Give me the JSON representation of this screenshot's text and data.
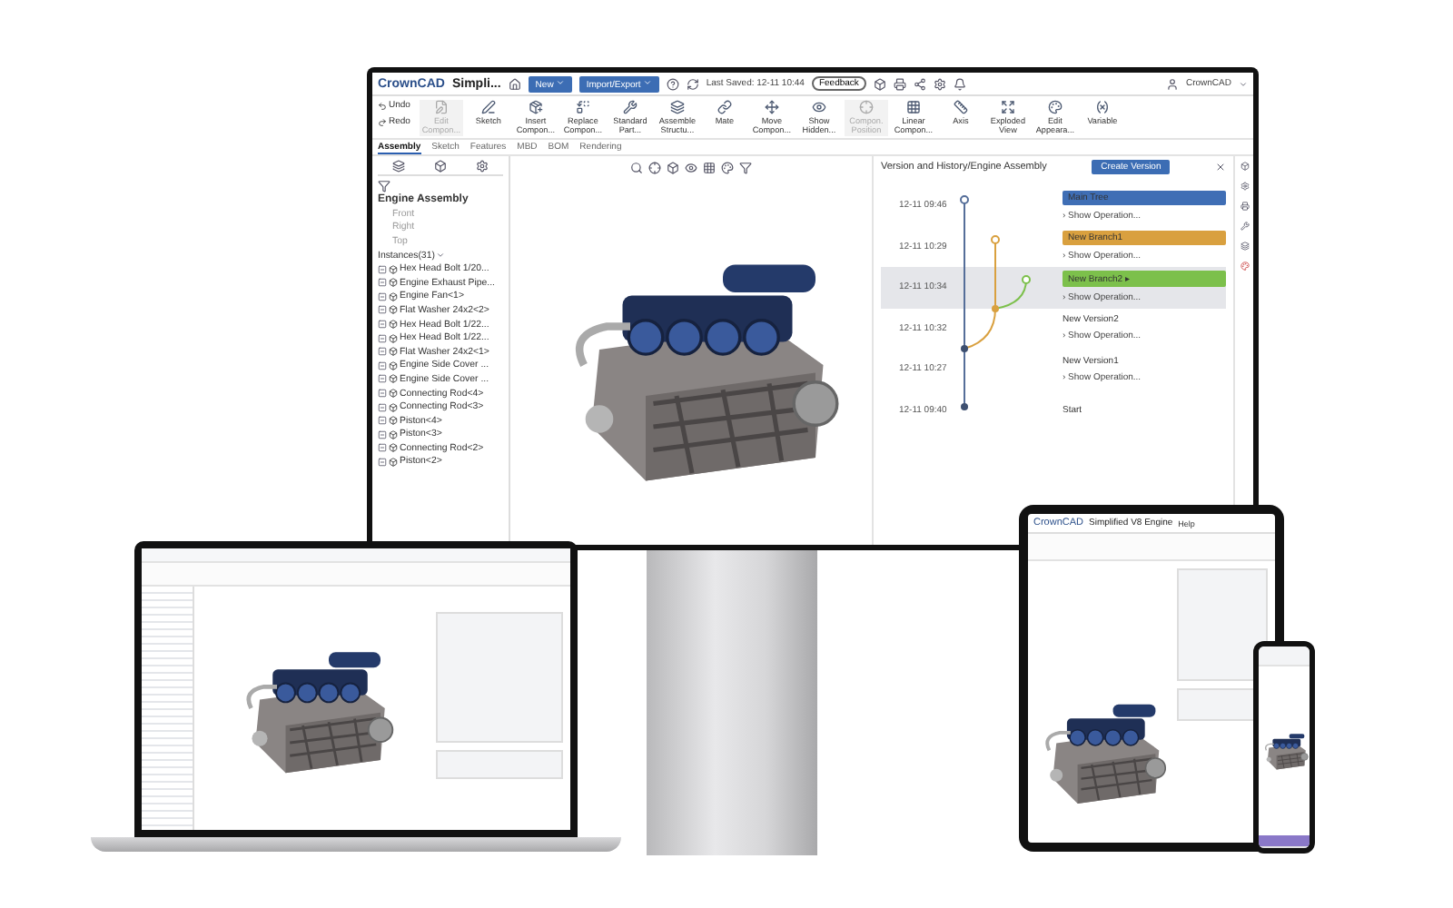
{
  "monitor": {
    "title_bar": {
      "logo": "CrownCAD",
      "document": "Simpli...",
      "buttons": [
        {
          "label": "New",
          "kind": "menu"
        },
        {
          "label": "Import/Export",
          "kind": "menu"
        }
      ],
      "last_saved": "Last Saved: 12-11 10:44",
      "feedback": "Feedback",
      "user": "CrownCAD"
    },
    "ribbon": {
      "history": [
        {
          "label": "Undo",
          "disabled": false
        },
        {
          "label": "Redo",
          "disabled": false
        }
      ],
      "tools": [
        {
          "label": "Edit Compon...",
          "disabled": true
        },
        {
          "label": "Sketch",
          "disabled": false
        },
        {
          "label": "Insert Compon...",
          "disabled": false
        },
        {
          "label": "Replace Compon...",
          "disabled": false
        },
        {
          "label": "Standard Part...",
          "disabled": false
        },
        {
          "label": "Assemble Structu...",
          "disabled": false
        },
        {
          "label": "Mate",
          "disabled": false
        },
        {
          "label": "Move Compon...",
          "disabled": false
        },
        {
          "label": "Show Hidden...",
          "disabled": false
        },
        {
          "label": "Compon. Position",
          "disabled": true
        },
        {
          "label": "Linear Compon...",
          "disabled": false
        },
        {
          "label": "Axis",
          "disabled": false
        },
        {
          "label": "Exploded View",
          "disabled": false
        },
        {
          "label": "Edit Appeara...",
          "disabled": false
        },
        {
          "label": "Variable",
          "disabled": false
        }
      ]
    },
    "ribbon_tabs": [
      {
        "label": "Assembly",
        "selected": true
      },
      {
        "label": "Sketch",
        "selected": false
      },
      {
        "label": "Features",
        "selected": false
      },
      {
        "label": "MBD",
        "selected": false
      },
      {
        "label": "BOM",
        "selected": false
      },
      {
        "label": "Rendering",
        "selected": false
      }
    ],
    "tree": {
      "root": "Engine Assembly",
      "planes": [
        "Front",
        "Right",
        "Top"
      ],
      "instances_header": "Instances(31)",
      "instances": [
        "Hex Head Bolt 1/20...",
        "Engine Exhaust Pipe...",
        "Engine Fan<1>",
        "Flat Washer 24x2<2>",
        "Hex Head Bolt 1/22...",
        "Hex Head Bolt 1/22...",
        "Flat Washer 24x2<1>",
        "Engine Side Cover ...",
        "Engine Side Cover ...",
        "Connecting Rod<4>",
        "Connecting Rod<3>",
        "Piston<4>",
        "Piston<3>",
        "Connecting Rod<2>",
        "Piston<2>"
      ]
    },
    "version_panel": {
      "title": "Version and History/Engine Assembly",
      "create_button": "Create Version",
      "rows": [
        {
          "time": "12-11 09:46",
          "kind": "badge",
          "label": "Main Tree",
          "color": "#3f6eb5",
          "selected": false,
          "operations": "› Show Operation..."
        },
        {
          "time": "12-11 10:29",
          "kind": "badge",
          "label": "New Branch1",
          "color": "#d9a03f",
          "selected": false,
          "operations": "› Show Operation..."
        },
        {
          "time": "12-11 10:34",
          "kind": "badge",
          "label": "New Branch2 ▸",
          "color": "#7cc04b",
          "selected": true,
          "operations": "› Show Operation..."
        },
        {
          "time": "12-11 10:32",
          "kind": "plain",
          "label": "New Version2",
          "selected": false,
          "operations": "› Show Operation..."
        },
        {
          "time": "12-11 10:27",
          "kind": "plain",
          "label": "New Version1",
          "selected": false,
          "operations": "› Show Operation..."
        },
        {
          "time": "12-11 09:40",
          "kind": "plain",
          "label": "Start",
          "selected": false
        }
      ]
    }
  },
  "tablet": {
    "logo": "CrownCAD",
    "document": "Simplified V8 Engine",
    "menu": "Help"
  }
}
